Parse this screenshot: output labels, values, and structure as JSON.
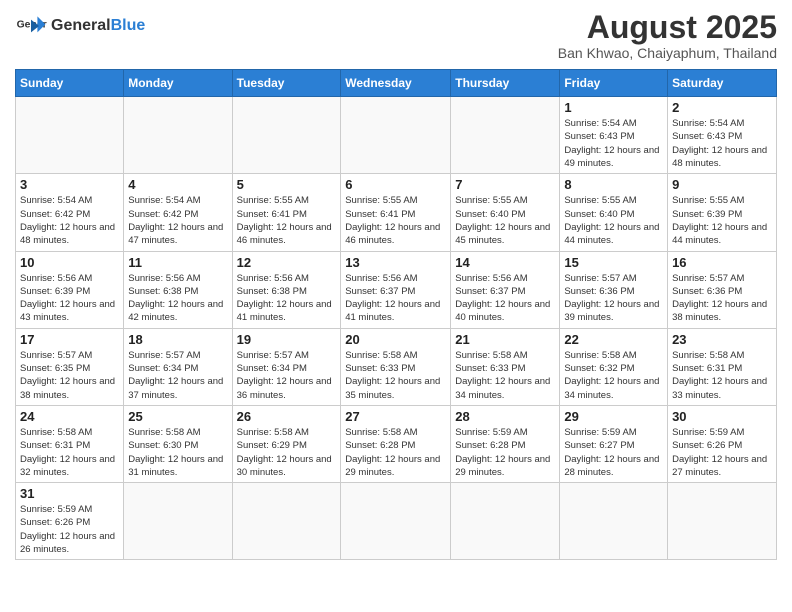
{
  "logo": {
    "text_general": "General",
    "text_blue": "Blue"
  },
  "title": "August 2025",
  "subtitle": "Ban Khwao, Chaiyaphum, Thailand",
  "days_of_week": [
    "Sunday",
    "Monday",
    "Tuesday",
    "Wednesday",
    "Thursday",
    "Friday",
    "Saturday"
  ],
  "weeks": [
    [
      {
        "day": "",
        "info": ""
      },
      {
        "day": "",
        "info": ""
      },
      {
        "day": "",
        "info": ""
      },
      {
        "day": "",
        "info": ""
      },
      {
        "day": "",
        "info": ""
      },
      {
        "day": "1",
        "info": "Sunrise: 5:54 AM\nSunset: 6:43 PM\nDaylight: 12 hours\nand 49 minutes."
      },
      {
        "day": "2",
        "info": "Sunrise: 5:54 AM\nSunset: 6:43 PM\nDaylight: 12 hours\nand 48 minutes."
      }
    ],
    [
      {
        "day": "3",
        "info": "Sunrise: 5:54 AM\nSunset: 6:42 PM\nDaylight: 12 hours\nand 48 minutes."
      },
      {
        "day": "4",
        "info": "Sunrise: 5:54 AM\nSunset: 6:42 PM\nDaylight: 12 hours\nand 47 minutes."
      },
      {
        "day": "5",
        "info": "Sunrise: 5:55 AM\nSunset: 6:41 PM\nDaylight: 12 hours\nand 46 minutes."
      },
      {
        "day": "6",
        "info": "Sunrise: 5:55 AM\nSunset: 6:41 PM\nDaylight: 12 hours\nand 46 minutes."
      },
      {
        "day": "7",
        "info": "Sunrise: 5:55 AM\nSunset: 6:40 PM\nDaylight: 12 hours\nand 45 minutes."
      },
      {
        "day": "8",
        "info": "Sunrise: 5:55 AM\nSunset: 6:40 PM\nDaylight: 12 hours\nand 44 minutes."
      },
      {
        "day": "9",
        "info": "Sunrise: 5:55 AM\nSunset: 6:39 PM\nDaylight: 12 hours\nand 44 minutes."
      }
    ],
    [
      {
        "day": "10",
        "info": "Sunrise: 5:56 AM\nSunset: 6:39 PM\nDaylight: 12 hours\nand 43 minutes."
      },
      {
        "day": "11",
        "info": "Sunrise: 5:56 AM\nSunset: 6:38 PM\nDaylight: 12 hours\nand 42 minutes."
      },
      {
        "day": "12",
        "info": "Sunrise: 5:56 AM\nSunset: 6:38 PM\nDaylight: 12 hours\nand 41 minutes."
      },
      {
        "day": "13",
        "info": "Sunrise: 5:56 AM\nSunset: 6:37 PM\nDaylight: 12 hours\nand 41 minutes."
      },
      {
        "day": "14",
        "info": "Sunrise: 5:56 AM\nSunset: 6:37 PM\nDaylight: 12 hours\nand 40 minutes."
      },
      {
        "day": "15",
        "info": "Sunrise: 5:57 AM\nSunset: 6:36 PM\nDaylight: 12 hours\nand 39 minutes."
      },
      {
        "day": "16",
        "info": "Sunrise: 5:57 AM\nSunset: 6:36 PM\nDaylight: 12 hours\nand 38 minutes."
      }
    ],
    [
      {
        "day": "17",
        "info": "Sunrise: 5:57 AM\nSunset: 6:35 PM\nDaylight: 12 hours\nand 38 minutes."
      },
      {
        "day": "18",
        "info": "Sunrise: 5:57 AM\nSunset: 6:34 PM\nDaylight: 12 hours\nand 37 minutes."
      },
      {
        "day": "19",
        "info": "Sunrise: 5:57 AM\nSunset: 6:34 PM\nDaylight: 12 hours\nand 36 minutes."
      },
      {
        "day": "20",
        "info": "Sunrise: 5:58 AM\nSunset: 6:33 PM\nDaylight: 12 hours\nand 35 minutes."
      },
      {
        "day": "21",
        "info": "Sunrise: 5:58 AM\nSunset: 6:33 PM\nDaylight: 12 hours\nand 34 minutes."
      },
      {
        "day": "22",
        "info": "Sunrise: 5:58 AM\nSunset: 6:32 PM\nDaylight: 12 hours\nand 34 minutes."
      },
      {
        "day": "23",
        "info": "Sunrise: 5:58 AM\nSunset: 6:31 PM\nDaylight: 12 hours\nand 33 minutes."
      }
    ],
    [
      {
        "day": "24",
        "info": "Sunrise: 5:58 AM\nSunset: 6:31 PM\nDaylight: 12 hours\nand 32 minutes."
      },
      {
        "day": "25",
        "info": "Sunrise: 5:58 AM\nSunset: 6:30 PM\nDaylight: 12 hours\nand 31 minutes."
      },
      {
        "day": "26",
        "info": "Sunrise: 5:58 AM\nSunset: 6:29 PM\nDaylight: 12 hours\nand 30 minutes."
      },
      {
        "day": "27",
        "info": "Sunrise: 5:58 AM\nSunset: 6:28 PM\nDaylight: 12 hours\nand 29 minutes."
      },
      {
        "day": "28",
        "info": "Sunrise: 5:59 AM\nSunset: 6:28 PM\nDaylight: 12 hours\nand 29 minutes."
      },
      {
        "day": "29",
        "info": "Sunrise: 5:59 AM\nSunset: 6:27 PM\nDaylight: 12 hours\nand 28 minutes."
      },
      {
        "day": "30",
        "info": "Sunrise: 5:59 AM\nSunset: 6:26 PM\nDaylight: 12 hours\nand 27 minutes."
      }
    ],
    [
      {
        "day": "31",
        "info": "Sunrise: 5:59 AM\nSunset: 6:26 PM\nDaylight: 12 hours\nand 26 minutes."
      },
      {
        "day": "",
        "info": ""
      },
      {
        "day": "",
        "info": ""
      },
      {
        "day": "",
        "info": ""
      },
      {
        "day": "",
        "info": ""
      },
      {
        "day": "",
        "info": ""
      },
      {
        "day": "",
        "info": ""
      }
    ]
  ]
}
